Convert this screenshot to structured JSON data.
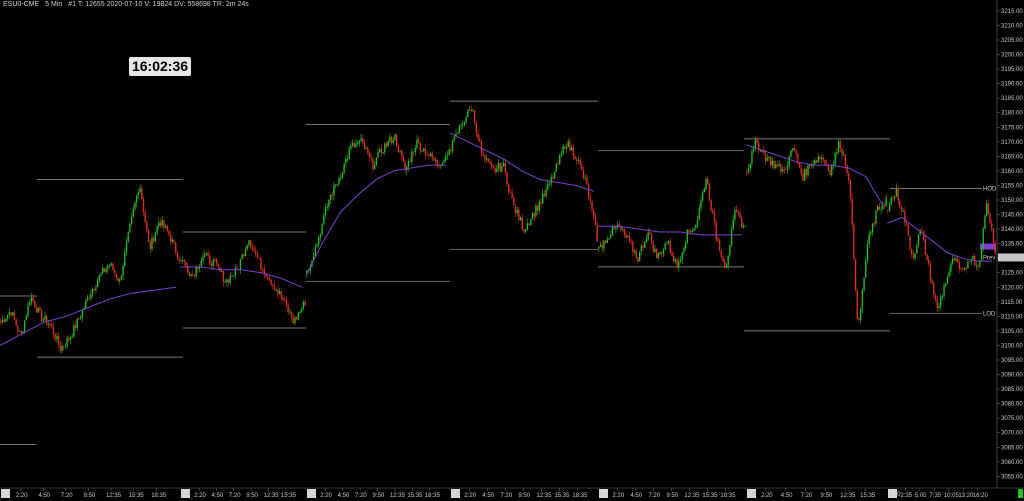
{
  "header": {
    "symbol": "ESU0-CME",
    "interval": "5 Min",
    "stats": "#1 T: 12655 2020-07-10 V: 19824 DV: 558698 TR: 2m 24s"
  },
  "clock": "16:02:36",
  "colors": {
    "background": "#000000",
    "up_candle": "#22c020",
    "down_candle": "#e03020",
    "vwap": "#7a3fd0",
    "level_line": "#9a9a9a",
    "current_price_marker": "#7a3fd0",
    "prev_close_marker": "#c8c8c8"
  },
  "chart_data": {
    "type": "candlestick",
    "title": "",
    "ylim": [
      3050,
      3220
    ],
    "y_ticks": [
      "3215.00",
      "3210.00",
      "3205.00",
      "3200.00",
      "3195.00",
      "3190.00",
      "3185.00",
      "3180.00",
      "3175.00",
      "3170.00",
      "3165.00",
      "3160.00",
      "3155.00",
      "3150.00",
      "3145.00",
      "3140.00",
      "3135.00",
      "3130.00",
      "3125.00",
      "3120.00",
      "3115.00",
      "3110.00",
      "3105.00",
      "3100.00",
      "3095.00",
      "3090.00",
      "3085.00",
      "3080.00",
      "3075.00",
      "3070.00",
      "3065.00",
      "3060.00",
      "3055.00"
    ],
    "sessions": [
      {
        "date_label": "7-3",
        "ticks": [
          "2:20",
          "4:50",
          "7:20",
          "9:50",
          "12:35",
          "15:35",
          "18:35"
        ],
        "path": [
          3108,
          3112,
          3103,
          3117,
          3110,
          3107,
          3099,
          3103,
          3110,
          3118,
          3124,
          3128,
          3122,
          3140,
          3156,
          3133,
          3143,
          3138,
          3130
        ],
        "vwap": [
          3100,
          3104,
          3108,
          3110,
          3113,
          3116,
          3118,
          3119,
          3120
        ]
      },
      {
        "date_label": "7-6",
        "ticks": [
          "2:20",
          "4:50",
          "7:20",
          "9:50",
          "12:35",
          "15:35"
        ],
        "path": [
          3130,
          3124,
          3131,
          3128,
          3122,
          3126,
          3137,
          3128,
          3122,
          3116,
          3108,
          3115
        ],
        "vwap": [
          3127,
          3127,
          3126,
          3126,
          3125,
          3123,
          3120
        ]
      },
      {
        "date_label": "7-7",
        "ticks": [
          "2:20",
          "4:50",
          "7:20",
          "9:50",
          "12:35",
          "15:35",
          "18:35"
        ],
        "path": [
          3125,
          3136,
          3150,
          3158,
          3168,
          3170,
          3162,
          3168,
          3172,
          3160,
          3170,
          3166,
          3162,
          3167
        ],
        "vwap": [
          3124,
          3136,
          3146,
          3152,
          3157,
          3160,
          3161,
          3162,
          3162
        ]
      },
      {
        "date_label": "7-8",
        "ticks": [
          "2:20",
          "4:50",
          "7:20",
          "9:50",
          "12:35",
          "15:35",
          "18:35"
        ],
        "path": [
          3168,
          3176,
          3182,
          3165,
          3160,
          3162,
          3148,
          3140,
          3146,
          3152,
          3160,
          3170,
          3165,
          3155,
          3137
        ],
        "vwap": [
          3173,
          3170,
          3167,
          3164,
          3160,
          3157,
          3156,
          3155,
          3153
        ]
      },
      {
        "date_label": "7-9",
        "ticks": [
          "2:20",
          "4:50",
          "7:20",
          "9:50",
          "12:35",
          "15:35",
          "18:35"
        ],
        "path": [
          3133,
          3138,
          3141,
          3136,
          3130,
          3139,
          3130,
          3136,
          3127,
          3138,
          3142,
          3158,
          3138,
          3127,
          3146,
          3140
        ],
        "vwap": [
          3141,
          3141,
          3140,
          3139,
          3139,
          3138,
          3138,
          3138
        ]
      },
      {
        "date_label": "7-9",
        "ticks": [
          "2:20",
          "4:50",
          "7:20",
          "9:50",
          "12:35",
          "15:35"
        ],
        "path": [
          3160,
          3170,
          3165,
          3162,
          3160,
          3168,
          3158,
          3163,
          3165,
          3160,
          3170,
          3158,
          3105,
          3135,
          3146,
          3150
        ],
        "vwap": [
          3169,
          3167,
          3165,
          3163,
          3162,
          3162,
          3161,
          3158,
          3148
        ]
      },
      {
        "date_label": "7-10",
        "ticks": [
          "2:35",
          "5:05",
          "7:35",
          "10:05",
          "13:20",
          "16:20"
        ],
        "path": [
          3148,
          3153,
          3144,
          3130,
          3140,
          3126,
          3112,
          3122,
          3130,
          3124,
          3131,
          3127,
          3149,
          3133
        ],
        "vwap": [
          3142,
          3144,
          3140,
          3136,
          3132,
          3130,
          3129,
          3129
        ]
      }
    ],
    "levels": [
      {
        "price": 3117,
        "label": ""
      },
      {
        "price": 3066,
        "label": ""
      },
      {
        "price": 3157,
        "label": ""
      },
      {
        "price": 3096,
        "label": ""
      },
      {
        "price": 3139,
        "label": ""
      },
      {
        "price": 3106,
        "label": ""
      },
      {
        "price": 3176,
        "label": ""
      },
      {
        "price": 3122,
        "label": ""
      },
      {
        "price": 3184,
        "label": ""
      },
      {
        "price": 3133,
        "label": ""
      },
      {
        "price": 3167,
        "label": ""
      },
      {
        "price": 3127,
        "label": ""
      },
      {
        "price": 3171,
        "label": ""
      },
      {
        "price": 3105,
        "label": ""
      },
      {
        "price": 3154,
        "label": "HOD"
      },
      {
        "price": 3111,
        "label": "LOD"
      }
    ],
    "current_price": {
      "value": 3134,
      "label": ""
    },
    "prev_close": {
      "value": 3130.25,
      "label": "3130.25",
      "tag": "Prev"
    }
  }
}
